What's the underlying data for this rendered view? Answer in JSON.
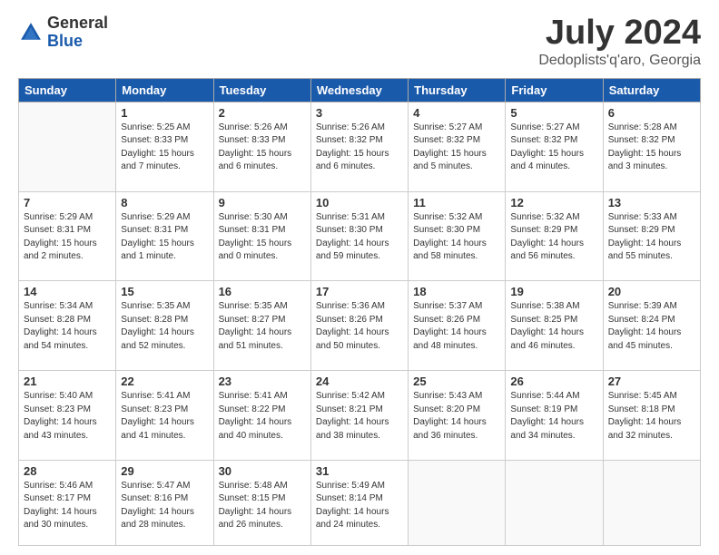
{
  "logo": {
    "general": "General",
    "blue": "Blue"
  },
  "header": {
    "title": "July 2024",
    "subtitle": "Dedoplists'q'aro, Georgia"
  },
  "weekdays": [
    "Sunday",
    "Monday",
    "Tuesday",
    "Wednesday",
    "Thursday",
    "Friday",
    "Saturday"
  ],
  "weeks": [
    [
      {
        "day": "",
        "info": ""
      },
      {
        "day": "1",
        "info": "Sunrise: 5:25 AM\nSunset: 8:33 PM\nDaylight: 15 hours\nand 7 minutes."
      },
      {
        "day": "2",
        "info": "Sunrise: 5:26 AM\nSunset: 8:33 PM\nDaylight: 15 hours\nand 6 minutes."
      },
      {
        "day": "3",
        "info": "Sunrise: 5:26 AM\nSunset: 8:32 PM\nDaylight: 15 hours\nand 6 minutes."
      },
      {
        "day": "4",
        "info": "Sunrise: 5:27 AM\nSunset: 8:32 PM\nDaylight: 15 hours\nand 5 minutes."
      },
      {
        "day": "5",
        "info": "Sunrise: 5:27 AM\nSunset: 8:32 PM\nDaylight: 15 hours\nand 4 minutes."
      },
      {
        "day": "6",
        "info": "Sunrise: 5:28 AM\nSunset: 8:32 PM\nDaylight: 15 hours\nand 3 minutes."
      }
    ],
    [
      {
        "day": "7",
        "info": "Sunrise: 5:29 AM\nSunset: 8:31 PM\nDaylight: 15 hours\nand 2 minutes."
      },
      {
        "day": "8",
        "info": "Sunrise: 5:29 AM\nSunset: 8:31 PM\nDaylight: 15 hours\nand 1 minute."
      },
      {
        "day": "9",
        "info": "Sunrise: 5:30 AM\nSunset: 8:31 PM\nDaylight: 15 hours\nand 0 minutes."
      },
      {
        "day": "10",
        "info": "Sunrise: 5:31 AM\nSunset: 8:30 PM\nDaylight: 14 hours\nand 59 minutes."
      },
      {
        "day": "11",
        "info": "Sunrise: 5:32 AM\nSunset: 8:30 PM\nDaylight: 14 hours\nand 58 minutes."
      },
      {
        "day": "12",
        "info": "Sunrise: 5:32 AM\nSunset: 8:29 PM\nDaylight: 14 hours\nand 56 minutes."
      },
      {
        "day": "13",
        "info": "Sunrise: 5:33 AM\nSunset: 8:29 PM\nDaylight: 14 hours\nand 55 minutes."
      }
    ],
    [
      {
        "day": "14",
        "info": "Sunrise: 5:34 AM\nSunset: 8:28 PM\nDaylight: 14 hours\nand 54 minutes."
      },
      {
        "day": "15",
        "info": "Sunrise: 5:35 AM\nSunset: 8:28 PM\nDaylight: 14 hours\nand 52 minutes."
      },
      {
        "day": "16",
        "info": "Sunrise: 5:35 AM\nSunset: 8:27 PM\nDaylight: 14 hours\nand 51 minutes."
      },
      {
        "day": "17",
        "info": "Sunrise: 5:36 AM\nSunset: 8:26 PM\nDaylight: 14 hours\nand 50 minutes."
      },
      {
        "day": "18",
        "info": "Sunrise: 5:37 AM\nSunset: 8:26 PM\nDaylight: 14 hours\nand 48 minutes."
      },
      {
        "day": "19",
        "info": "Sunrise: 5:38 AM\nSunset: 8:25 PM\nDaylight: 14 hours\nand 46 minutes."
      },
      {
        "day": "20",
        "info": "Sunrise: 5:39 AM\nSunset: 8:24 PM\nDaylight: 14 hours\nand 45 minutes."
      }
    ],
    [
      {
        "day": "21",
        "info": "Sunrise: 5:40 AM\nSunset: 8:23 PM\nDaylight: 14 hours\nand 43 minutes."
      },
      {
        "day": "22",
        "info": "Sunrise: 5:41 AM\nSunset: 8:23 PM\nDaylight: 14 hours\nand 41 minutes."
      },
      {
        "day": "23",
        "info": "Sunrise: 5:41 AM\nSunset: 8:22 PM\nDaylight: 14 hours\nand 40 minutes."
      },
      {
        "day": "24",
        "info": "Sunrise: 5:42 AM\nSunset: 8:21 PM\nDaylight: 14 hours\nand 38 minutes."
      },
      {
        "day": "25",
        "info": "Sunrise: 5:43 AM\nSunset: 8:20 PM\nDaylight: 14 hours\nand 36 minutes."
      },
      {
        "day": "26",
        "info": "Sunrise: 5:44 AM\nSunset: 8:19 PM\nDaylight: 14 hours\nand 34 minutes."
      },
      {
        "day": "27",
        "info": "Sunrise: 5:45 AM\nSunset: 8:18 PM\nDaylight: 14 hours\nand 32 minutes."
      }
    ],
    [
      {
        "day": "28",
        "info": "Sunrise: 5:46 AM\nSunset: 8:17 PM\nDaylight: 14 hours\nand 30 minutes."
      },
      {
        "day": "29",
        "info": "Sunrise: 5:47 AM\nSunset: 8:16 PM\nDaylight: 14 hours\nand 28 minutes."
      },
      {
        "day": "30",
        "info": "Sunrise: 5:48 AM\nSunset: 8:15 PM\nDaylight: 14 hours\nand 26 minutes."
      },
      {
        "day": "31",
        "info": "Sunrise: 5:49 AM\nSunset: 8:14 PM\nDaylight: 14 hours\nand 24 minutes."
      },
      {
        "day": "",
        "info": ""
      },
      {
        "day": "",
        "info": ""
      },
      {
        "day": "",
        "info": ""
      }
    ]
  ]
}
